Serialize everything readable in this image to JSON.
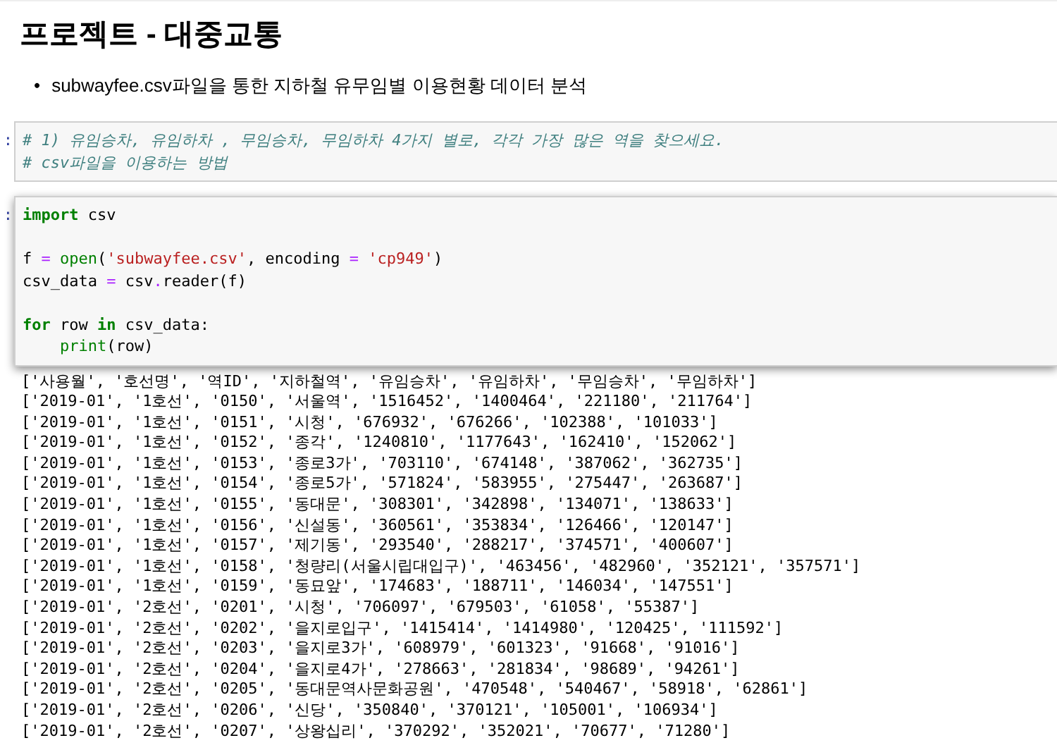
{
  "heading": "프로젝트 - 대중교통",
  "bullets": [
    {
      "marker": "•",
      "text": "subwayfee.csv파일을 통한 지하철 유무임별 이용현황 데이터 분석"
    }
  ],
  "cells": [
    {
      "prompt": ":",
      "selected": false,
      "lines": [
        {
          "tokens": [
            {
              "kind": "comment",
              "text": "# 1) 유임승차, 유임하차 , 무임승차, 무임하차 4가지 별로, 각각 가장 많은 역을 찾으세요."
            }
          ]
        },
        {
          "tokens": [
            {
              "kind": "comment",
              "text": "# csv파일을 이용하는 방법"
            }
          ]
        }
      ]
    },
    {
      "prompt": ":",
      "selected": true,
      "lines": [
        {
          "tokens": [
            {
              "kind": "keyword",
              "text": "import"
            },
            {
              "kind": "plain",
              "text": " csv"
            }
          ]
        },
        {
          "gap_before": true,
          "tokens": [
            {
              "kind": "plain",
              "text": "f "
            },
            {
              "kind": "operator",
              "text": "= "
            },
            {
              "kind": "builtin",
              "text": "open"
            },
            {
              "kind": "plain",
              "text": "("
            },
            {
              "kind": "string",
              "text": "'subwayfee.csv'"
            },
            {
              "kind": "plain",
              "text": ", encoding "
            },
            {
              "kind": "operator",
              "text": "= "
            },
            {
              "kind": "string",
              "text": "'cp949'"
            },
            {
              "kind": "plain",
              "text": ")"
            }
          ]
        },
        {
          "tokens": [
            {
              "kind": "plain",
              "text": "csv_data "
            },
            {
              "kind": "operator",
              "text": "="
            },
            {
              "kind": "plain",
              "text": " csv"
            },
            {
              "kind": "operator",
              "text": "."
            },
            {
              "kind": "plain",
              "text": "reader(f)"
            }
          ]
        },
        {
          "gap_before": true,
          "tokens": [
            {
              "kind": "keyword",
              "text": "for"
            },
            {
              "kind": "plain",
              "text": " row "
            },
            {
              "kind": "keyword",
              "text": "in"
            },
            {
              "kind": "plain",
              "text": " csv_data:"
            }
          ]
        },
        {
          "indent": true,
          "tokens": [
            {
              "kind": "builtin",
              "text": "print"
            },
            {
              "kind": "plain",
              "text": "(row)"
            }
          ]
        }
      ]
    }
  ],
  "output": [
    "['사용월', '호선명', '역ID', '지하철역', '유임승차', '유임하차', '무임승차', '무임하차']",
    "['2019-01', '1호선', '0150', '서울역', '1516452', '1400464', '221180', '211764']",
    "['2019-01', '1호선', '0151', '시청', '676932', '676266', '102388', '101033']",
    "['2019-01', '1호선', '0152', '종각', '1240810', '1177643', '162410', '152062']",
    "['2019-01', '1호선', '0153', '종로3가', '703110', '674148', '387062', '362735']",
    "['2019-01', '1호선', '0154', '종로5가', '571824', '583955', '275447', '263687']",
    "['2019-01', '1호선', '0155', '동대문', '308301', '342898', '134071', '138633']",
    "['2019-01', '1호선', '0156', '신설동', '360561', '353834', '126466', '120147']",
    "['2019-01', '1호선', '0157', '제기동', '293540', '288217', '374571', '400607']",
    "['2019-01', '1호선', '0158', '청량리(서울시립대입구)', '463456', '482960', '352121', '357571']",
    "['2019-01', '1호선', '0159', '동묘앞', '174683', '188711', '146034', '147551']",
    "['2019-01', '2호선', '0201', '시청', '706097', '679503', '61058', '55387']",
    "['2019-01', '2호선', '0202', '을지로입구', '1415414', '1414980', '120425', '111592']",
    "['2019-01', '2호선', '0203', '을지로3가', '608979', '601323', '91668', '91016']",
    "['2019-01', '2호선', '0204', '을지로4가', '278663', '281834', '98689', '94261']",
    "['2019-01', '2호선', '0205', '동대문역사문화공원', '470548', '540467', '58918', '62861']",
    "['2019-01', '2호선', '0206', '신당', '350840', '370121', '105001', '106934']",
    "['2019-01', '2호선', '0207', '상왕십리', '370292', '352021', '70677', '71280']"
  ]
}
